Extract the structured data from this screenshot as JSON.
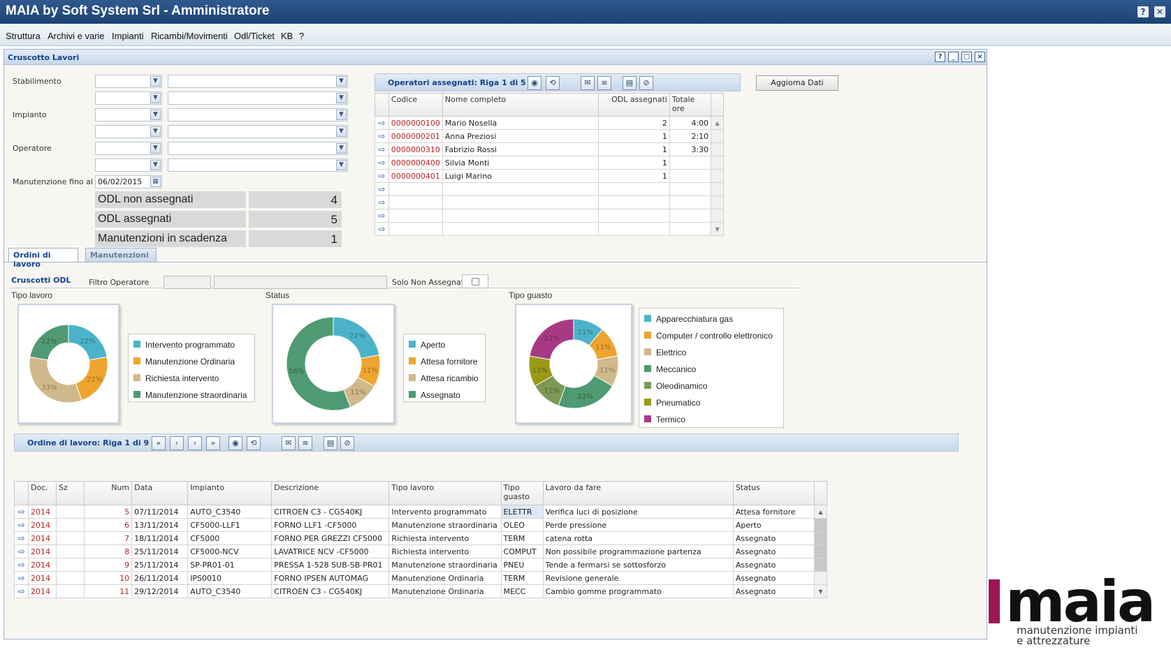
{
  "window": {
    "title": "MAIA by Soft System Srl - Amministratore",
    "help_btn": "?",
    "close_btn": "✕"
  },
  "menu": [
    "Struttura",
    "Archivi e varie",
    "Impianti",
    "Ricambi/Movimenti",
    "Odl/Ticket",
    "KB",
    "?"
  ],
  "panel": {
    "title": "Cruscotto Lavori"
  },
  "filters": {
    "stabilimento_label": "Stabilimento",
    "impianto_label": "Impianto",
    "operatore_label": "Operatore",
    "manutenzione_label": "Manutenzione fino al",
    "date_value": "06/02/2015"
  },
  "counters": [
    {
      "label": "ODL non assegnati",
      "value": "4"
    },
    {
      "label": "ODL assegnati",
      "value": "5"
    },
    {
      "label": "Manutenzioni in scadenza",
      "value": "1"
    }
  ],
  "operators_grid": {
    "title": "Operatori assegnati: Riga 1 di 5",
    "columns": [
      "Codice",
      "Nome completo",
      "ODL assegnati",
      "Totale ore"
    ],
    "rows": [
      [
        "0000000100",
        "Mario Nosella",
        "2",
        "4:00"
      ],
      [
        "0000000201",
        "Anna Preziosi",
        "1",
        "2:10"
      ],
      [
        "0000000310",
        "Fabrizio Rossi",
        "1",
        "3:30"
      ],
      [
        "0000000400",
        "Silvia Monti",
        "1",
        ""
      ],
      [
        "0000000401",
        "Luigi Marino",
        "1",
        ""
      ]
    ]
  },
  "refresh_button": "Aggiorna Dati",
  "tabs": [
    "Ordini di lavoro",
    "Manutenzioni"
  ],
  "odl_section": {
    "title": "Cruscotti ODL",
    "filter_label": "Filtro Operatore",
    "solo_label": "Solo Non Assegnati"
  },
  "charts": {
    "tipo_lavoro": {
      "title": "Tipo lavoro",
      "slices": [
        {
          "name": "Intervento programmato",
          "pct": "22%",
          "value": 22,
          "color": "#4bb3c9"
        },
        {
          "name": "Manutenzione Ordinaria",
          "pct": "22%",
          "value": 22,
          "color": "#eda52f"
        },
        {
          "name": "Richiesta intervento",
          "pct": "33%",
          "value": 33,
          "color": "#cfb98a"
        },
        {
          "name": "Manutenzione straordinaria",
          "pct": "22%",
          "value": 22,
          "color": "#4f9a72"
        }
      ]
    },
    "status": {
      "title": "Status",
      "slices": [
        {
          "name": "Aperto",
          "pct": "22%",
          "value": 22,
          "color": "#4bb3c9"
        },
        {
          "name": "Attesa fornitore",
          "pct": "11%",
          "value": 11,
          "color": "#eda52f"
        },
        {
          "name": "Attesa ricambio",
          "pct": "11%",
          "value": 11,
          "color": "#cfb98a"
        },
        {
          "name": "Assegnato",
          "pct": "56%",
          "value": 56,
          "color": "#4f9a72"
        }
      ]
    },
    "tipo_guasto": {
      "title": "Tipo guasto",
      "slices": [
        {
          "name": "Apparecchiatura gas",
          "pct": "11%",
          "value": 11,
          "color": "#4bb3c9"
        },
        {
          "name": "Computer / controllo elettronico",
          "pct": "11%",
          "value": 11,
          "color": "#eda52f"
        },
        {
          "name": "Elettrico",
          "pct": "11%",
          "value": 11,
          "color": "#cfb98a"
        },
        {
          "name": "Meccanico",
          "pct": "22%",
          "value": 22,
          "color": "#4f9a72"
        },
        {
          "name": "Oleodinamico",
          "pct": "11%",
          "value": 11,
          "color": "#7c9a55"
        },
        {
          "name": "Pneumatico",
          "pct": "11%",
          "value": 11,
          "color": "#9a9a18"
        },
        {
          "name": "Termico",
          "pct": "22%",
          "value": 22,
          "color": "#a83a85"
        }
      ]
    }
  },
  "odl_grid": {
    "title": "Ordine di lavoro: Riga 1 di 9",
    "nav": [
      "«",
      "‹",
      "›",
      "»"
    ],
    "columns": [
      "Doc.",
      "Sz",
      "Num",
      "Data",
      "Impianto",
      "Descrizione",
      "Tipo lavoro",
      "Tipo guasto",
      "Lavoro da fare",
      "Status"
    ],
    "rows": [
      [
        "2014",
        "",
        "5",
        "07/11/2014",
        "AUTO_C3540",
        "CITROEN C3 - CG540KJ",
        "Intervento programmato",
        "ELETTR",
        "Verifica luci di posizione",
        "Attesa fornitore"
      ],
      [
        "2014",
        "",
        "6",
        "13/11/2014",
        "CF5000-LLF1",
        "FORNO LLF1 -CF5000",
        "Manutenzione straordinaria",
        "OLEO",
        "Perde pressione",
        "Aperto"
      ],
      [
        "2014",
        "",
        "7",
        "18/11/2014",
        "CF5000",
        "FORNO PER GREZZI CF5000",
        "Richiesta intervento",
        "TERM",
        "catena rotta",
        "Assegnato"
      ],
      [
        "2014",
        "",
        "8",
        "25/11/2014",
        "CF5000-NCV",
        "LAVATRICE NCV -CF5000",
        "Richiesta intervento",
        "COMPUT",
        "Non possibile programmazione partenza",
        "Assegnato"
      ],
      [
        "2014",
        "",
        "9",
        "25/11/2014",
        "SP-PR01-01",
        "PRESSA 1-528 SUB-SB-PR01",
        "Manutenzione straordinaria",
        "PNEU",
        "Tende a fermarsi se sottosforzo",
        "Assegnato"
      ],
      [
        "2014",
        "",
        "10",
        "26/11/2014",
        "IPS0010",
        "FORNO IPSEN AUTOMAG",
        "Manutenzione Ordinaria",
        "TERM",
        "Revisione generale",
        "Assegnato"
      ],
      [
        "2014",
        "",
        "11",
        "29/12/2014",
        "AUTO_C3540",
        "CITROEN C3 - CG540KJ",
        "Manutenzione Ordinaria",
        "MECC",
        "Cambio gomme programmato",
        "Assegnato"
      ]
    ]
  },
  "logo": {
    "word": "maia",
    "tagline1": "manutenzione impianti",
    "tagline2": "e attrezzature",
    "color": "#9c1753"
  }
}
